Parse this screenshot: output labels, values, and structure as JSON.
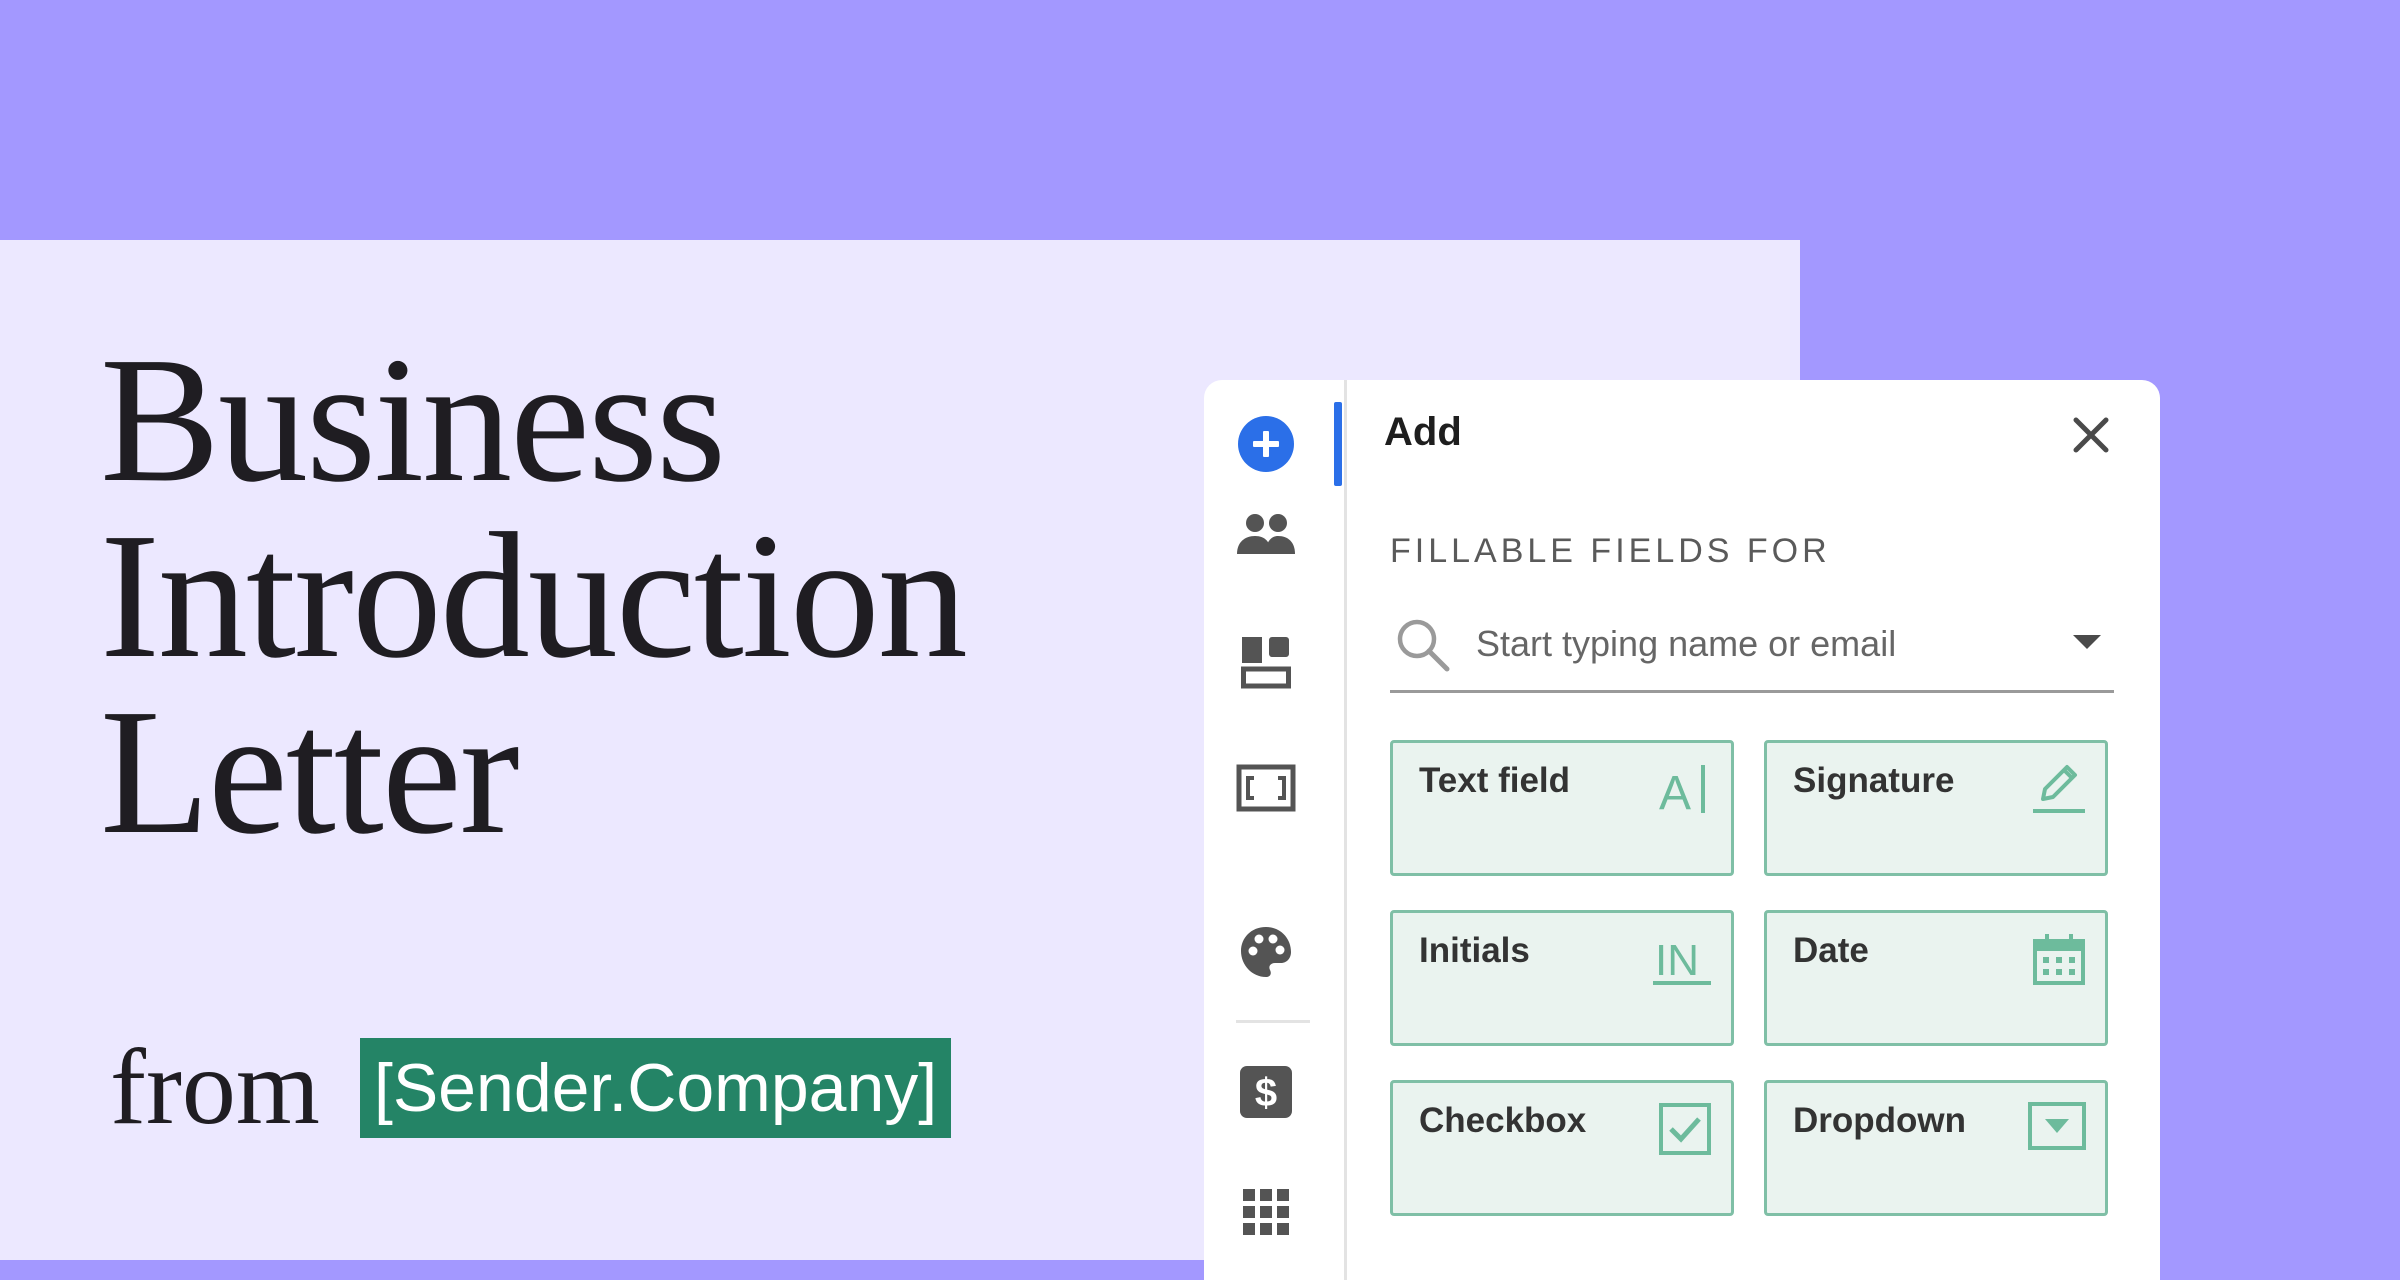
{
  "title": {
    "line1": "Business",
    "line2": "Introduction",
    "line3": "Letter"
  },
  "from_label": "from",
  "company_placeholder": "[Sender.Company]",
  "panel": {
    "title": "Add",
    "section_label": "FILLABLE FIELDS FOR",
    "search_placeholder": "Start typing name or email"
  },
  "fields": [
    {
      "label": "Text field",
      "icon": "text-cursor-icon"
    },
    {
      "label": "Signature",
      "icon": "pen-icon"
    },
    {
      "label": "Initials",
      "icon": "initials-icon"
    },
    {
      "label": "Date",
      "icon": "calendar-icon"
    },
    {
      "label": "Checkbox",
      "icon": "checkbox-icon"
    },
    {
      "label": "Dropdown",
      "icon": "dropdown-icon"
    }
  ],
  "rail_icons": [
    "add-icon",
    "people-icon",
    "layout-icon",
    "fit-icon",
    "palette-icon",
    "dollar-icon",
    "grid-icon"
  ],
  "colors": {
    "accent_purple": "#a398ff",
    "light_panel": "#ece8ff",
    "company_green": "#248466",
    "field_border": "#7fbfa6",
    "field_bg": "#eaf3ef",
    "active_blue": "#2b6fe8"
  }
}
